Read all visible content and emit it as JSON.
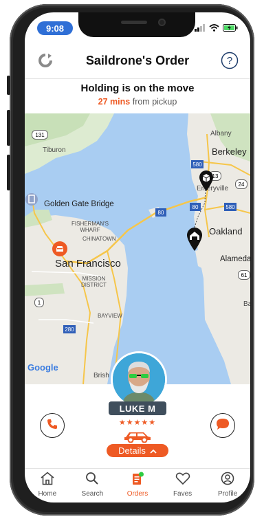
{
  "status_bar": {
    "time": "9:08"
  },
  "header": {
    "title": "Saildrone's Order"
  },
  "trip_status": {
    "headline": "Holding is on the move",
    "eta": "27 mins",
    "eta_suffix": "from pickup"
  },
  "map": {
    "labels": {
      "albany": "Albany",
      "tiburon": "Tiburon",
      "berkeley": "Berkeley",
      "emeryville": "Emeryville",
      "golden_gate": "Golden Gate Bridge",
      "fishermans": "FISHERMAN'S\nWHARF",
      "chinatown": "CHINATOWN",
      "oakland": "Oakland",
      "san_francisco": "San Francisco",
      "alameda": "Alameda",
      "mission": "MISSION\nDISTRICT",
      "bayview": "BAYVIEW",
      "brisbane": "Brish",
      "ba": "Ba",
      "logo": "Google"
    },
    "shields": {
      "r131": "131",
      "i580a": "580",
      "r13": "13",
      "r24": "24",
      "i80a": "80",
      "i80b": "80",
      "i580b": "580",
      "r61": "61",
      "r1": "1",
      "i280": "280"
    }
  },
  "driver": {
    "name": "LUKE M",
    "rating_stars": "★★★★★",
    "rating_value": 5
  },
  "details_button": {
    "label": "Details"
  },
  "tabs": [
    {
      "label": "Home",
      "icon": "home-icon"
    },
    {
      "label": "Search",
      "icon": "search-icon"
    },
    {
      "label": "Orders",
      "icon": "orders-icon",
      "active": true
    },
    {
      "label": "Faves",
      "icon": "heart-icon"
    },
    {
      "label": "Profile",
      "icon": "profile-icon"
    }
  ],
  "colors": {
    "accent": "#ee5a24",
    "time_pill": "#2f6fd6",
    "water": "#a9cdf2",
    "land": "#eceae4"
  }
}
